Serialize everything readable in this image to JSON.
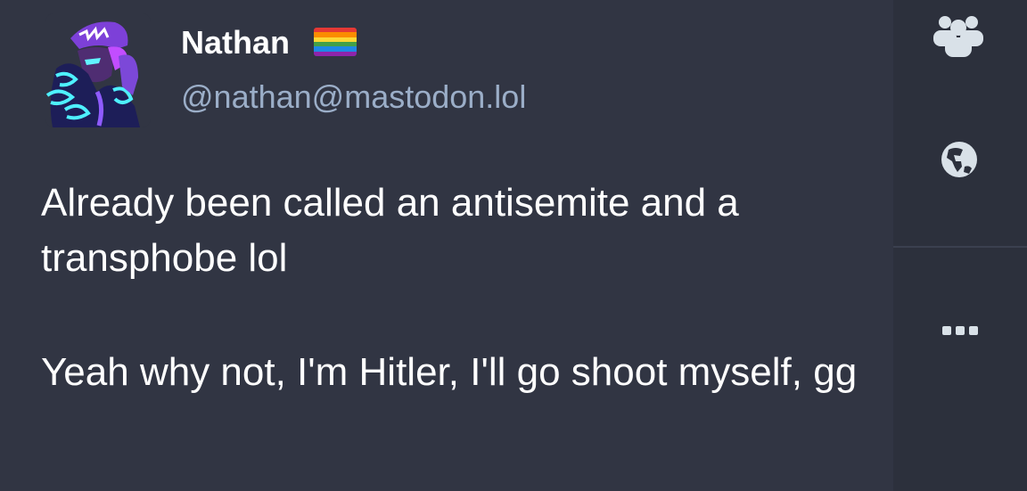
{
  "post": {
    "display_name": "Nathan",
    "handle": "@nathan@mastodon.lol",
    "paragraphs": [
      "Already been called an antisemite and a transphobe lol",
      "Yeah why not, I'm Hitler, I'll go shoot myself, gg"
    ]
  },
  "icons": {
    "avatar": "avatar-image",
    "flag": "pride-flag-icon",
    "sidebar": [
      "users-icon",
      "globe-icon",
      "more-options-icon"
    ]
  },
  "colors": {
    "background": "#282c37",
    "post_background": "#313543",
    "sidebar_background": "#2c303c",
    "text": "#ffffff",
    "handle": "#9baec8",
    "icon": "#d9e1e8"
  }
}
